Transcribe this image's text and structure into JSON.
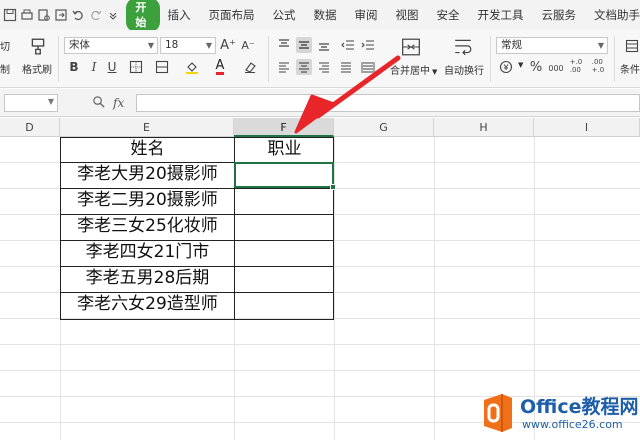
{
  "menubar": {
    "start_label": "开始",
    "items": [
      "插入",
      "页面布局",
      "公式",
      "数据",
      "审阅",
      "视图",
      "安全",
      "开发工具",
      "云服务",
      "文档助手"
    ]
  },
  "ribbon": {
    "cut_label": "切",
    "copy_label": "制",
    "format_painter_label": "格式刷",
    "font_name": "宋体",
    "font_size": "18",
    "merge_center_label": "合并居中",
    "wrap_text_label": "自动换行",
    "number_format": "常规",
    "percent_symbol": "%",
    "thousands_symbol": "000",
    "inc_decimal_symbol": "+.0\n.00",
    "dec_decimal_symbol": ".00\n+.0",
    "conditional_label": "条件",
    "font_grow": "A⁺",
    "font_shrink": "A⁻",
    "bold": "B",
    "italic": "I",
    "underline": "U",
    "font_color_glyph": "A"
  },
  "formula_bar": {
    "fx_label": "fx",
    "value": ""
  },
  "sheet": {
    "columns": [
      "D",
      "E",
      "F",
      "G",
      "H",
      "I"
    ],
    "selected_column": "F",
    "table": {
      "header_name": "姓名",
      "header_job": "职业",
      "rows": [
        "李老大男20摄影师",
        "李老二男20摄影师",
        "李老三女25化妆师",
        "李老四女21门市",
        "李老五男28后期",
        "李老六女29造型师"
      ]
    }
  },
  "watermark": {
    "line1": "Office教程网",
    "line2": "www.office26.com"
  },
  "colors": {
    "accent_green": "#217346",
    "start_green": "#3ca03c",
    "arrow_red": "#e8262a",
    "watermark_orange": "#f0701a",
    "watermark_blue": "#1f5fa8"
  }
}
